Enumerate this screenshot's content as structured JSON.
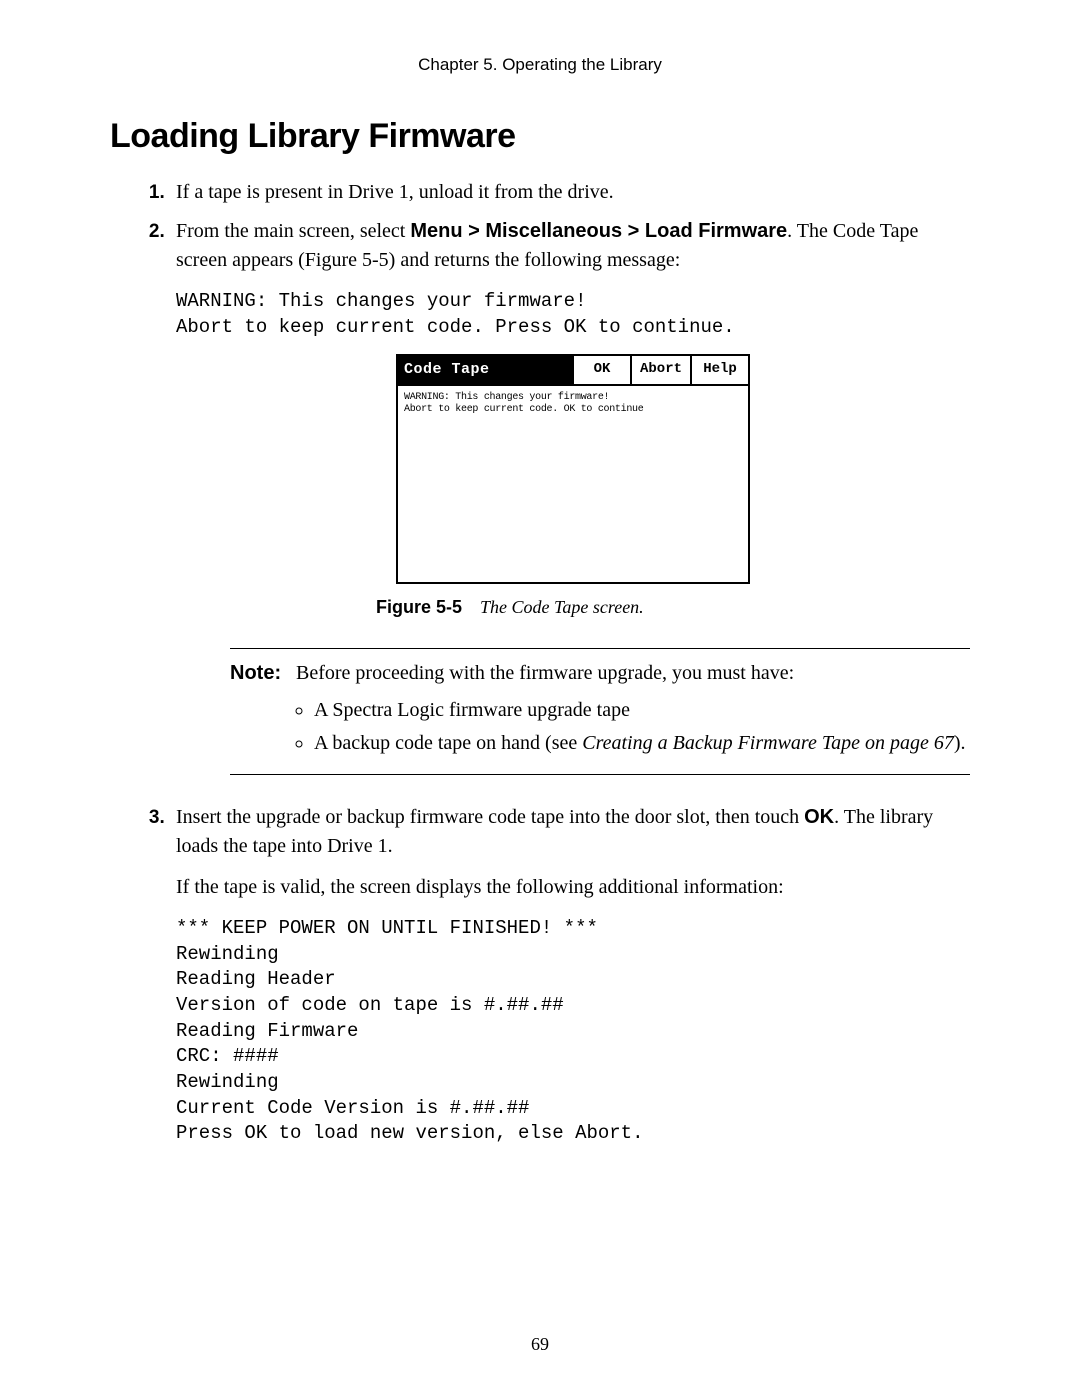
{
  "header": {
    "running": "Chapter 5.  Operating the Library"
  },
  "title": "Loading Library Firmware",
  "steps": {
    "s1": "If a tape is present in Drive 1, unload it from the drive.",
    "s2_a": "From the main screen, select ",
    "s2_b": "Menu > Miscellaneous > Load Firmware",
    "s2_c": ". The Code Tape screen appears (Figure 5-5) and returns the following message:",
    "s2_code": "WARNING: This changes your firmware!\nAbort to keep current code. Press OK to continue.",
    "s3_a": "Insert the upgrade or backup firmware code tape into the door slot, then touch ",
    "s3_b": "OK",
    "s3_c": ". The library loads the tape into Drive 1.",
    "s3_para": "If the tape is valid, the screen displays the following additional information:",
    "s3_code": "*** KEEP POWER ON UNTIL FINISHED! ***\nRewinding\nReading Header\nVersion of code on tape is #.##.##\nReading Firmware\nCRC: ####\nRewinding\nCurrent Code Version is #.##.##\nPress OK to load new version, else Abort."
  },
  "figure": {
    "screen_title": "Code Tape",
    "btn_ok": "OK",
    "btn_abort": "Abort",
    "btn_help": "Help",
    "body": "WARNING: This changes your firmware!\nAbort to keep current code. OK to continue",
    "caption_label": "Figure 5-5",
    "caption_text": "The Code Tape screen."
  },
  "note": {
    "label": "Note:",
    "intro": "Before proceeding with the firmware upgrade, you must have:",
    "b1": "A Spectra Logic firmware upgrade tape",
    "b2_a": "A backup code tape on hand (see ",
    "b2_b": "Creating a Backup Firmware Tape on page 67",
    "b2_c": ")."
  },
  "page_number": "69"
}
